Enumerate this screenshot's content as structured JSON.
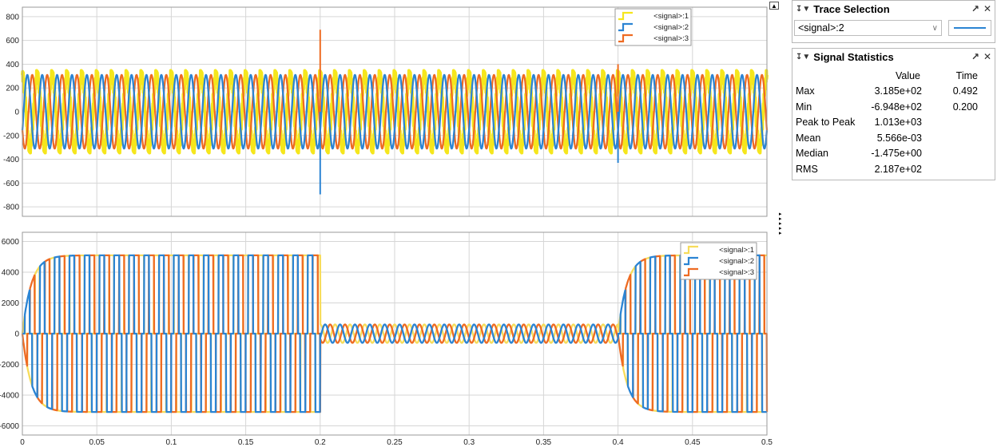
{
  "chart_data": [
    {
      "type": "line",
      "title": "",
      "xlabel": "",
      "ylabel": "",
      "xlim": [
        0,
        0.5
      ],
      "ylim": [
        -880,
        880
      ],
      "grid": true,
      "legend_position": "top-right",
      "y_ticks": [
        800,
        600,
        400,
        200,
        0,
        -200,
        -400,
        -600,
        -800
      ],
      "y_tick_labels": [
        "800",
        "600",
        "400",
        "200",
        "0",
        "-200",
        "-400",
        "-600",
        "-800"
      ],
      "series": [
        {
          "name": "<signal>:1",
          "color": "#f5e61c",
          "amplitude": 310,
          "frequency_hz": 100,
          "phase_deg": 90,
          "note_ripple": true
        },
        {
          "name": "<signal>:2",
          "color": "#2b84d3",
          "amplitude": 310,
          "frequency_hz": 100,
          "phase_deg": -30
        },
        {
          "name": "<signal>:3",
          "color": "#ee6b22",
          "amplitude": 310,
          "frequency_hz": 100,
          "phase_deg": 210
        }
      ],
      "spikes": [
        {
          "x": 0.2,
          "series": "<signal>:3",
          "y_max": 690
        },
        {
          "x": 0.2,
          "series": "<signal>:2",
          "y_min": -695
        },
        {
          "x": 0.4,
          "series": "<signal>:3",
          "y_max": 400
        },
        {
          "x": 0.4,
          "series": "<signal>:2",
          "y_min": -430
        }
      ]
    },
    {
      "type": "line",
      "title": "",
      "xlabel": "",
      "ylabel": "",
      "xlim": [
        0,
        0.5
      ],
      "ylim": [
        -6600,
        6600
      ],
      "grid": true,
      "legend_position": "top-right",
      "x_ticks": [
        0,
        0.05,
        0.1,
        0.15,
        0.2,
        0.25,
        0.3,
        0.35,
        0.4,
        0.45,
        0.5
      ],
      "x_tick_labels": [
        "0",
        "0.05",
        "0.1",
        "0.15",
        "0.2",
        "0.25",
        "0.3",
        "0.35",
        "0.4",
        "0.45",
        "0.5"
      ],
      "y_ticks": [
        6000,
        4000,
        2000,
        0,
        -2000,
        -4000,
        -6000
      ],
      "y_tick_labels": [
        "6000",
        "4000",
        "2000",
        "0",
        "-2000",
        "-4000",
        "-6000"
      ],
      "segments": [
        {
          "x_range": [
            0,
            0.2
          ],
          "shape": "quasi-square",
          "amplitude": 5100,
          "frequency_hz": 100
        },
        {
          "x_range": [
            0.2,
            0.4
          ],
          "shape": "sine",
          "amplitude": 600,
          "frequency_hz": 100
        },
        {
          "x_range": [
            0.4,
            0.5
          ],
          "shape": "quasi-square",
          "amplitude": 5100,
          "frequency_hz": 100
        }
      ],
      "series": [
        {
          "name": "<signal>:1",
          "color": "#f7dc5a",
          "phase_deg": 90
        },
        {
          "name": "<signal>:2",
          "color": "#2b84d3",
          "phase_deg": -30
        },
        {
          "name": "<signal>:3",
          "color": "#ee6b22",
          "phase_deg": 210
        }
      ]
    }
  ],
  "trace_selection": {
    "title": "Trace Selection",
    "selected": "<signal>:2",
    "color": "#2b84d3"
  },
  "signal_statistics": {
    "title": "Signal Statistics",
    "headers": [
      "",
      "Value",
      "Time"
    ],
    "rows": [
      [
        "Max",
        "3.185e+02",
        "0.492"
      ],
      [
        "Min",
        "-6.948e+02",
        "0.200"
      ],
      [
        "Peak to Peak",
        "1.013e+03",
        ""
      ],
      [
        "Mean",
        "5.566e-03",
        ""
      ],
      [
        "Median",
        "-1.475e+00",
        ""
      ],
      [
        "RMS",
        "2.187e+02",
        ""
      ]
    ]
  },
  "icons": {
    "pin": "pin-icon",
    "undock": "undock-icon",
    "close": "close-icon",
    "expand": "expand-icon"
  }
}
